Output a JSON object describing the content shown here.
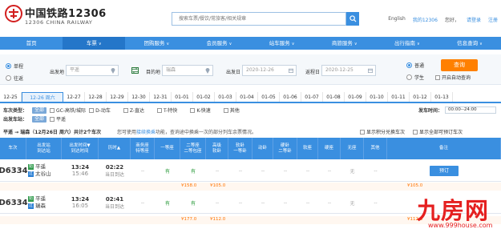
{
  "header": {
    "logo_cn": "中国铁路12306",
    "logo_en": "12306 CHINA RAILWAY",
    "search_placeholder": "搜索车票/餐饮/常旅客/相关规章",
    "links": [
      "English",
      "我的12306",
      "您好，",
      "请登录",
      "注册"
    ]
  },
  "nav": {
    "items": [
      {
        "label": "首页",
        "arrow": ""
      },
      {
        "label": "车票",
        "arrow": "∨"
      },
      {
        "label": "团购服务",
        "arrow": "∨"
      },
      {
        "label": "会员服务",
        "arrow": "∨"
      },
      {
        "label": "站车服务",
        "arrow": "∨"
      },
      {
        "label": "商旅服务",
        "arrow": "∨"
      },
      {
        "label": "出行指南",
        "arrow": "∨"
      },
      {
        "label": "信息查询",
        "arrow": "∨"
      }
    ]
  },
  "query": {
    "trip_oneway": "单程",
    "trip_round": "往返",
    "from_label": "出发地",
    "from_value": "平遥",
    "to_label": "目的地",
    "to_value": "瑞森",
    "date_label": "出发日",
    "date_value": "2020-12-26",
    "return_label": "返程日",
    "return_value": "2020-12-25",
    "type_normal": "普通",
    "type_student": "学生",
    "query_btn": "查询",
    "auto_query": "开启自动查询"
  },
  "dates": [
    "12-25",
    "12-26 周六",
    "12-27",
    "12-28",
    "12-29",
    "12-30",
    "12-31",
    "01-01",
    "01-02",
    "01-03",
    "01-04",
    "01-05",
    "01-06",
    "01-07",
    "01-08",
    "01-09",
    "01-10",
    "01-11",
    "01-12",
    "01-13"
  ],
  "filters": {
    "type_label": "车次类型：",
    "all": "全部",
    "types": [
      "GC-高铁/城际",
      "D-动车",
      "Z-直达",
      "T-特快",
      "K-快速",
      "其他"
    ],
    "station_label": "出发车站：",
    "station": "平遥",
    "time_label": "发车时间：",
    "time_value": "00:00--24:00"
  },
  "summary": {
    "route": "平遥 → 瑞森（12月26日 周六）共计2个车次",
    "note_pre": "您可使用",
    "note_link": "接续换乘",
    "note_post": "功能，查询途中换乘一次的部分列车余票情况。",
    "opt1": "显示积分兑换车次",
    "opt2": "显示全部可预订车次"
  },
  "table": {
    "headers": [
      "车次",
      "出发站\n到达站",
      "出发时间▼\n到达时间",
      "历时▲",
      "商务座\n特等座",
      "一等座",
      "二等座\n二等包座",
      "高级\n软卧",
      "软卧\n一等卧",
      "动卧",
      "硬卧\n二等卧",
      "软座",
      "硬座",
      "无座",
      "其他",
      "备注"
    ],
    "rows": [
      {
        "no": "D6334",
        "from": "平遥",
        "to": "太谷山",
        "from_badge": "始",
        "to_badge": "过",
        "dep": "13:24",
        "arr": "15:46",
        "dur": "02:22",
        "day": "当日到达",
        "seats": [
          "--",
          "有",
          "有",
          "--",
          "--",
          "--",
          "--",
          "--",
          "--",
          "无",
          "--"
        ],
        "book": "预订",
        "prices": [
          "¥158.0",
          "¥105.0",
          "¥105.0"
        ]
      },
      {
        "no": "D6334",
        "from": "平遥",
        "to": "瑞森",
        "from_badge": "始",
        "to_badge": "过",
        "dep": "13:24",
        "arr": "16:05",
        "dur": "02:41",
        "day": "当日到达",
        "seats": [
          "--",
          "有",
          "有",
          "--",
          "--",
          "--",
          "--",
          "--",
          "--",
          "无",
          "--"
        ],
        "book": "",
        "prices": [
          "¥177.0",
          "¥112.0",
          "¥112.0"
        ]
      }
    ]
  },
  "watermark": {
    "text": "九房网",
    "url": "www.999house.com"
  },
  "colors": {
    "brand_blue": "#3a8fe0",
    "orange": "#ff8000",
    "green": "#2a9a3a",
    "red_watermark": "#e52020"
  }
}
